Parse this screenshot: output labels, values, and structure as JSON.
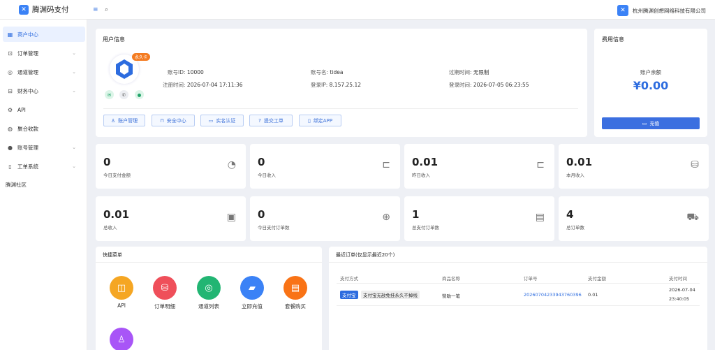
{
  "app": {
    "name": "腾渊码支付",
    "company": "杭州腾渊创想网络科技有限公司"
  },
  "sidebar": {
    "items": [
      {
        "label": "商户中心",
        "icon": "grid-icon",
        "active": true
      },
      {
        "label": "订单管理",
        "icon": "bag-icon",
        "chevron": true
      },
      {
        "label": "通道管理",
        "icon": "globe-icon",
        "chevron": true
      },
      {
        "label": "财务中心",
        "icon": "briefcase-icon",
        "chevron": true
      },
      {
        "label": "API",
        "icon": "settings-icon"
      },
      {
        "label": "聚合收款",
        "icon": "palette-icon"
      },
      {
        "label": "账号管理",
        "icon": "user-icon",
        "chevron": true
      },
      {
        "label": "工单系统",
        "icon": "book-icon",
        "chevron": true
      }
    ],
    "community": "腾渊社区"
  },
  "user": {
    "title": "用户信息",
    "badge": "永久卡",
    "account_id_label": "账号ID:",
    "account_id": "10000",
    "account_name_label": "账号名:",
    "account_name": "tidea",
    "expire_label": "过期时间:",
    "expire": "无限制",
    "register_label": "注册时间:",
    "register": "2026-07-04 17:11:36",
    "login_ip_label": "登录IP:",
    "login_ip": "8.157.25.12",
    "login_time_label": "登录时间:",
    "login_time": "2026-07-05 06:23:55",
    "buttons": [
      "账户管理",
      "安全中心",
      "实名认证",
      "提交工单",
      "绑定APP"
    ]
  },
  "fees": {
    "title": "费用信息",
    "balance_label": "账户余额",
    "balance": "¥0.00",
    "recharge": "充值"
  },
  "stats": [
    {
      "value": "0",
      "label": "今日支付金额",
      "icon": "gauge-icon"
    },
    {
      "value": "0",
      "label": "今日收入",
      "icon": "folder-icon"
    },
    {
      "value": "0.01",
      "label": "昨日收入",
      "icon": "folder-icon"
    },
    {
      "value": "0.01",
      "label": "本月收入",
      "icon": "coins-icon"
    },
    {
      "value": "0.01",
      "label": "总收入",
      "icon": "cash-icon"
    },
    {
      "value": "0",
      "label": "今日支付订单数",
      "icon": "target-icon"
    },
    {
      "value": "1",
      "label": "总支付订单数",
      "icon": "card-icon"
    },
    {
      "value": "4",
      "label": "总订单数",
      "icon": "cart-icon"
    }
  ],
  "quick": {
    "title": "快捷菜单",
    "items": [
      {
        "label": "API",
        "color": "#f5a623",
        "icon": "chip-icon"
      },
      {
        "label": "订单明细",
        "color": "#ef4f5a",
        "icon": "database-icon"
      },
      {
        "label": "通道列表",
        "color": "#22b573",
        "icon": "lifebuoy-icon"
      },
      {
        "label": "立即充值",
        "color": "#3b82f6",
        "icon": "wallet-icon"
      },
      {
        "label": "套餐购买",
        "color": "#f97316",
        "icon": "clipboard-icon"
      },
      {
        "label": "",
        "color": "#a855f7",
        "icon": "user-icon"
      }
    ]
  },
  "orders": {
    "title": "最近订单(仅显示最近20个)",
    "headers": [
      "支付方式",
      "商品名称",
      "订单号",
      "支付金额",
      "支付时间"
    ],
    "rows": [
      {
        "method": "支付宝",
        "method_note": "支付宝无敌免挂永久不掉线",
        "product": "赞助一笔",
        "order_no": "20260704233943760396",
        "amount": "0.01",
        "date": "2026-07-04",
        "time": "23:40:05"
      }
    ]
  }
}
